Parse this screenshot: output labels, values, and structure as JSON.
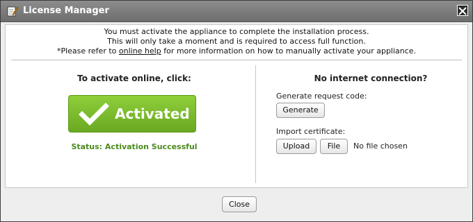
{
  "window": {
    "title": "License Manager"
  },
  "notice": {
    "line1": "You must activate the appliance to complete the installation process.",
    "line2": "This will only take a moment and is required to access full function.",
    "line3_prefix": "*Please refer to ",
    "line3_link": "online help",
    "line3_suffix": " for more information on how to manually activate your appliance."
  },
  "online": {
    "heading": "To activate online, click:",
    "button_label": "Activated",
    "status": "Status: Activation Successful",
    "accent_color": "#79bb2c",
    "icon": "check-icon"
  },
  "offline": {
    "heading": "No internet connection?",
    "generate_label": "Generate request code:",
    "generate_button": "Generate",
    "import_label": "Import certificate:",
    "upload_button": "Upload",
    "file_button": "File",
    "file_status": "No file chosen"
  },
  "footer": {
    "close_button": "Close"
  }
}
